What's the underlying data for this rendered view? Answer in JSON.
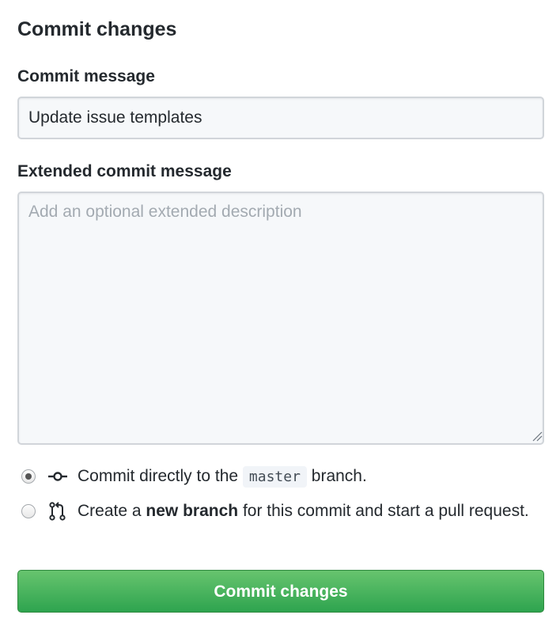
{
  "form": {
    "heading": "Commit changes",
    "commit_message_label": "Commit message",
    "commit_message_value": "Update issue templates",
    "extended_label": "Extended commit message",
    "extended_placeholder": "Add an optional extended description",
    "options": {
      "direct": {
        "selected": true,
        "icon": "git-commit-icon",
        "text_before": "Commit directly to the",
        "branch": "master",
        "text_after": "branch."
      },
      "new_branch": {
        "selected": false,
        "icon": "git-pull-request-icon",
        "text_before": "Create a",
        "bold": "new branch",
        "text_after": "for this commit and start a pull request."
      }
    },
    "submit_label": "Commit changes"
  },
  "colors": {
    "button_green": "#2ea44f",
    "text": "#24292e",
    "input_bg": "#f6f8fa",
    "border": "#d1d5da"
  }
}
